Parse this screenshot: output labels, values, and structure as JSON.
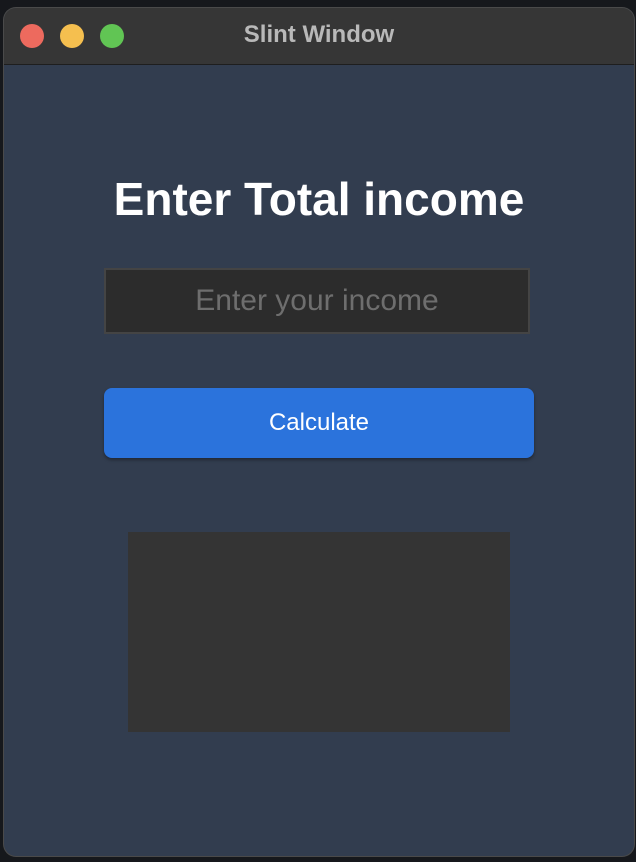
{
  "window": {
    "title": "Slint Window"
  },
  "main": {
    "heading": "Enter Total income",
    "income_input": {
      "value": "",
      "placeholder": "Enter your income"
    },
    "calculate_label": "Calculate",
    "result_text": ""
  },
  "colors": {
    "background": "#323d4f",
    "titlebar": "#363636",
    "button": "#2b73dc",
    "input_bg": "#2c2c2c",
    "result_bg": "#343434"
  }
}
